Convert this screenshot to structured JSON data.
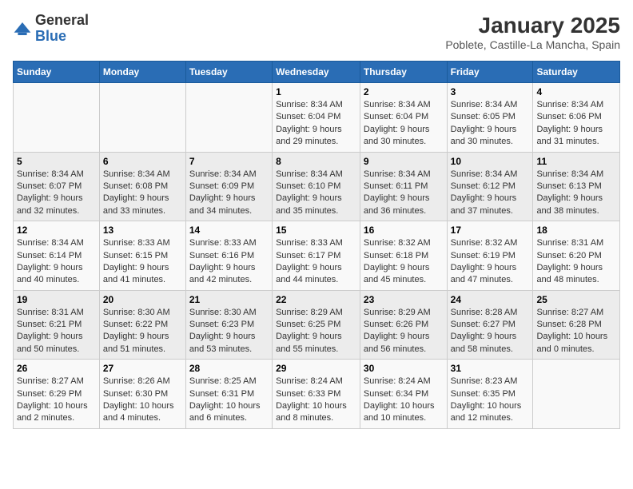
{
  "logo": {
    "general": "General",
    "blue": "Blue"
  },
  "title": "January 2025",
  "subtitle": "Poblete, Castille-La Mancha, Spain",
  "days_of_week": [
    "Sunday",
    "Monday",
    "Tuesday",
    "Wednesday",
    "Thursday",
    "Friday",
    "Saturday"
  ],
  "weeks": [
    [
      {
        "day": "",
        "sunrise": "",
        "sunset": "",
        "daylight": ""
      },
      {
        "day": "",
        "sunrise": "",
        "sunset": "",
        "daylight": ""
      },
      {
        "day": "",
        "sunrise": "",
        "sunset": "",
        "daylight": ""
      },
      {
        "day": "1",
        "sunrise": "Sunrise: 8:34 AM",
        "sunset": "Sunset: 6:04 PM",
        "daylight": "Daylight: 9 hours and 29 minutes."
      },
      {
        "day": "2",
        "sunrise": "Sunrise: 8:34 AM",
        "sunset": "Sunset: 6:04 PM",
        "daylight": "Daylight: 9 hours and 30 minutes."
      },
      {
        "day": "3",
        "sunrise": "Sunrise: 8:34 AM",
        "sunset": "Sunset: 6:05 PM",
        "daylight": "Daylight: 9 hours and 30 minutes."
      },
      {
        "day": "4",
        "sunrise": "Sunrise: 8:34 AM",
        "sunset": "Sunset: 6:06 PM",
        "daylight": "Daylight: 9 hours and 31 minutes."
      }
    ],
    [
      {
        "day": "5",
        "sunrise": "Sunrise: 8:34 AM",
        "sunset": "Sunset: 6:07 PM",
        "daylight": "Daylight: 9 hours and 32 minutes."
      },
      {
        "day": "6",
        "sunrise": "Sunrise: 8:34 AM",
        "sunset": "Sunset: 6:08 PM",
        "daylight": "Daylight: 9 hours and 33 minutes."
      },
      {
        "day": "7",
        "sunrise": "Sunrise: 8:34 AM",
        "sunset": "Sunset: 6:09 PM",
        "daylight": "Daylight: 9 hours and 34 minutes."
      },
      {
        "day": "8",
        "sunrise": "Sunrise: 8:34 AM",
        "sunset": "Sunset: 6:10 PM",
        "daylight": "Daylight: 9 hours and 35 minutes."
      },
      {
        "day": "9",
        "sunrise": "Sunrise: 8:34 AM",
        "sunset": "Sunset: 6:11 PM",
        "daylight": "Daylight: 9 hours and 36 minutes."
      },
      {
        "day": "10",
        "sunrise": "Sunrise: 8:34 AM",
        "sunset": "Sunset: 6:12 PM",
        "daylight": "Daylight: 9 hours and 37 minutes."
      },
      {
        "day": "11",
        "sunrise": "Sunrise: 8:34 AM",
        "sunset": "Sunset: 6:13 PM",
        "daylight": "Daylight: 9 hours and 38 minutes."
      }
    ],
    [
      {
        "day": "12",
        "sunrise": "Sunrise: 8:34 AM",
        "sunset": "Sunset: 6:14 PM",
        "daylight": "Daylight: 9 hours and 40 minutes."
      },
      {
        "day": "13",
        "sunrise": "Sunrise: 8:33 AM",
        "sunset": "Sunset: 6:15 PM",
        "daylight": "Daylight: 9 hours and 41 minutes."
      },
      {
        "day": "14",
        "sunrise": "Sunrise: 8:33 AM",
        "sunset": "Sunset: 6:16 PM",
        "daylight": "Daylight: 9 hours and 42 minutes."
      },
      {
        "day": "15",
        "sunrise": "Sunrise: 8:33 AM",
        "sunset": "Sunset: 6:17 PM",
        "daylight": "Daylight: 9 hours and 44 minutes."
      },
      {
        "day": "16",
        "sunrise": "Sunrise: 8:32 AM",
        "sunset": "Sunset: 6:18 PM",
        "daylight": "Daylight: 9 hours and 45 minutes."
      },
      {
        "day": "17",
        "sunrise": "Sunrise: 8:32 AM",
        "sunset": "Sunset: 6:19 PM",
        "daylight": "Daylight: 9 hours and 47 minutes."
      },
      {
        "day": "18",
        "sunrise": "Sunrise: 8:31 AM",
        "sunset": "Sunset: 6:20 PM",
        "daylight": "Daylight: 9 hours and 48 minutes."
      }
    ],
    [
      {
        "day": "19",
        "sunrise": "Sunrise: 8:31 AM",
        "sunset": "Sunset: 6:21 PM",
        "daylight": "Daylight: 9 hours and 50 minutes."
      },
      {
        "day": "20",
        "sunrise": "Sunrise: 8:30 AM",
        "sunset": "Sunset: 6:22 PM",
        "daylight": "Daylight: 9 hours and 51 minutes."
      },
      {
        "day": "21",
        "sunrise": "Sunrise: 8:30 AM",
        "sunset": "Sunset: 6:23 PM",
        "daylight": "Daylight: 9 hours and 53 minutes."
      },
      {
        "day": "22",
        "sunrise": "Sunrise: 8:29 AM",
        "sunset": "Sunset: 6:25 PM",
        "daylight": "Daylight: 9 hours and 55 minutes."
      },
      {
        "day": "23",
        "sunrise": "Sunrise: 8:29 AM",
        "sunset": "Sunset: 6:26 PM",
        "daylight": "Daylight: 9 hours and 56 minutes."
      },
      {
        "day": "24",
        "sunrise": "Sunrise: 8:28 AM",
        "sunset": "Sunset: 6:27 PM",
        "daylight": "Daylight: 9 hours and 58 minutes."
      },
      {
        "day": "25",
        "sunrise": "Sunrise: 8:27 AM",
        "sunset": "Sunset: 6:28 PM",
        "daylight": "Daylight: 10 hours and 0 minutes."
      }
    ],
    [
      {
        "day": "26",
        "sunrise": "Sunrise: 8:27 AM",
        "sunset": "Sunset: 6:29 PM",
        "daylight": "Daylight: 10 hours and 2 minutes."
      },
      {
        "day": "27",
        "sunrise": "Sunrise: 8:26 AM",
        "sunset": "Sunset: 6:30 PM",
        "daylight": "Daylight: 10 hours and 4 minutes."
      },
      {
        "day": "28",
        "sunrise": "Sunrise: 8:25 AM",
        "sunset": "Sunset: 6:31 PM",
        "daylight": "Daylight: 10 hours and 6 minutes."
      },
      {
        "day": "29",
        "sunrise": "Sunrise: 8:24 AM",
        "sunset": "Sunset: 6:33 PM",
        "daylight": "Daylight: 10 hours and 8 minutes."
      },
      {
        "day": "30",
        "sunrise": "Sunrise: 8:24 AM",
        "sunset": "Sunset: 6:34 PM",
        "daylight": "Daylight: 10 hours and 10 minutes."
      },
      {
        "day": "31",
        "sunrise": "Sunrise: 8:23 AM",
        "sunset": "Sunset: 6:35 PM",
        "daylight": "Daylight: 10 hours and 12 minutes."
      },
      {
        "day": "",
        "sunrise": "",
        "sunset": "",
        "daylight": ""
      }
    ]
  ]
}
